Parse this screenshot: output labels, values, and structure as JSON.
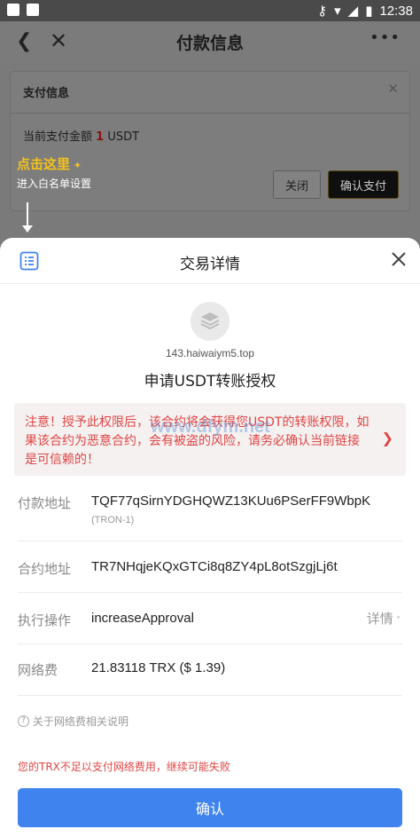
{
  "status_bar": {
    "time": "12:38"
  },
  "background_app": {
    "title": "付款信息",
    "dialog": {
      "header": "支付信息",
      "amount_prefix": "当前支付金额",
      "amount_value": "1",
      "amount_unit": "USDT",
      "close_label": "关闭",
      "confirm_label": "确认支付"
    },
    "hint": {
      "title": "点击这里",
      "subtitle": "进入白名单设置"
    }
  },
  "sheet": {
    "title": "交易详情",
    "site_url": "143.haiwaiym5.top",
    "auth_title": "申请USDT转账授权",
    "warning": "注意！授予此权限后，该合约将会获得您USDT的转账权限，如果该合约为恶意合约，会有被盗的风险，请务必确认当前链接是可信赖的！",
    "watermark": "www.dfym.net",
    "rows": [
      {
        "label": "付款地址",
        "value": "TQF77qSirnYDGHQWZ13KUu6PSerFF9WbpK",
        "sub": "(TRON-1)"
      },
      {
        "label": "合约地址",
        "value": "TR7NHqjeKQxGTCi8q8ZY4pL8otSzgjLj6t"
      },
      {
        "label": "执行操作",
        "value": "increaseApproval",
        "detail": "详情"
      },
      {
        "label": "网络费",
        "value": "21.83118 TRX ($ 1.39)"
      }
    ],
    "fee_help": "关于网络费相关说明",
    "fee_warning": "您的TRX不足以支付网络费用，继续可能失败",
    "confirm_label": "确认"
  },
  "colors": {
    "primary": "#3f83ef",
    "warning_text": "#e04545",
    "hint_yellow": "#f4c21a"
  }
}
